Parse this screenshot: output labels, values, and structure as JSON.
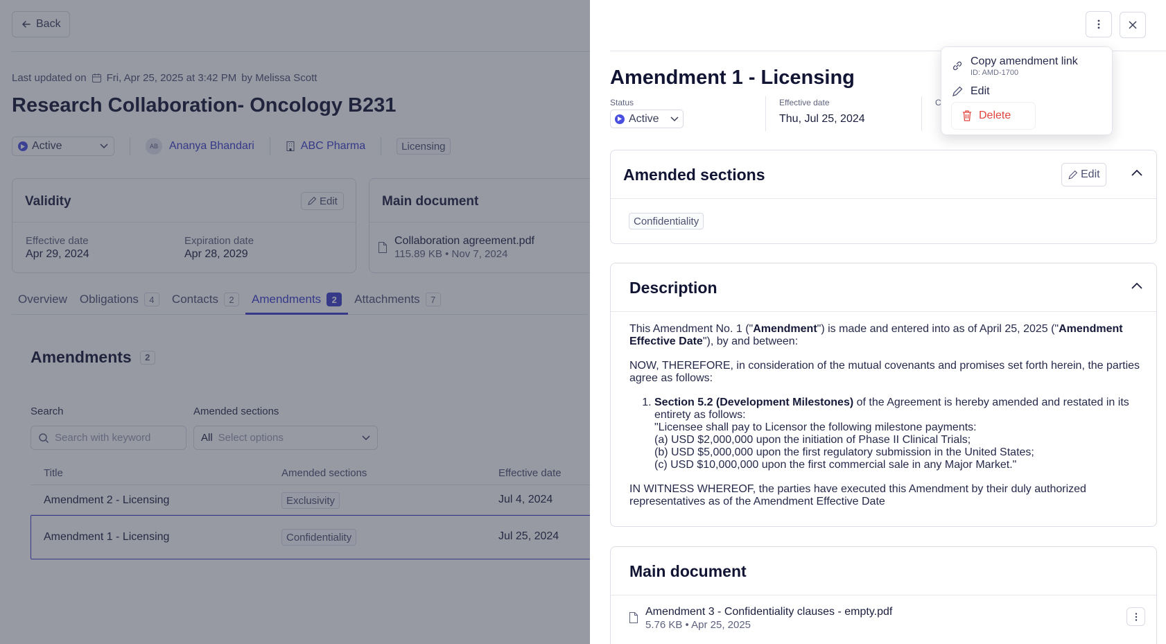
{
  "header": {
    "back_label": "Back",
    "last_updated_prefix": "Last updated on",
    "last_updated_date": "Fri, Apr 25, 2025 at 3:42 PM",
    "last_updated_by": "by Melissa Scott",
    "title": "Research Collaboration- Oncology B231",
    "status": "Active",
    "owner_initials": "AB",
    "owner_name": "Ananya Bhandari",
    "company": "ABC Pharma",
    "category": "Licensing"
  },
  "validity": {
    "title": "Validity",
    "edit_label": "Edit",
    "effective_label": "Effective date",
    "effective_value": "Apr 29, 2024",
    "expiration_label": "Expiration date",
    "expiration_value": "Apr 28, 2029"
  },
  "main_document_card": {
    "title": "Main document",
    "file_name": "Collaboration agreement.pdf",
    "file_meta": "115.89 KB • Nov 7, 2024"
  },
  "tabs": [
    {
      "label": "Overview",
      "count": ""
    },
    {
      "label": "Obligations",
      "count": "4"
    },
    {
      "label": "Contacts",
      "count": "2"
    },
    {
      "label": "Amendments",
      "count": "2"
    },
    {
      "label": "Attachments",
      "count": "7"
    }
  ],
  "amendments": {
    "title": "Amendments",
    "count": "2",
    "search_label": "Search",
    "search_placeholder": "Search with keyword",
    "sections_label": "Amended sections",
    "sections_all": "All",
    "sections_placeholder": "Select options",
    "columns": [
      "Title",
      "Amended sections",
      "Effective date"
    ],
    "rows": [
      {
        "title": "Amendment 2 - Licensing",
        "section": "Exclusivity",
        "date": "Jul 4, 2024"
      },
      {
        "title": "Amendment 1 - Licensing",
        "section": "Confidentiality",
        "date": "Jul 25, 2024"
      }
    ]
  },
  "panel": {
    "title": "Amendment 1 - Licensing",
    "status_label": "Status",
    "status_value": "Active",
    "effective_label": "Effective date",
    "effective_value": "Thu, Jul 25, 2024",
    "third_label_fragment": "C",
    "amended_sections": {
      "title": "Amended sections",
      "edit_label": "Edit",
      "tag": "Confidentiality"
    },
    "description": {
      "title": "Description",
      "p1_a": "This Amendment No. 1 (\"",
      "p1_b": "Amendment",
      "p1_c": "\") is made and entered into as of April 25, 2025 (\"",
      "p1_d": "Amendment Effective Date",
      "p1_e": "\"), by and between:",
      "p2": "NOW, THEREFORE, in consideration of the mutual covenants and promises set forth herein, the parties agree as follows:",
      "li_bold": "Section 5.2 (Development Milestones)",
      "li_rest": " of the Agreement is hereby amended and restated in its entirety as follows:",
      "li_line1": "\"Licensee shall pay to Licensor the following milestone payments:",
      "li_line2": "(a) USD $2,000,000 upon the initiation of Phase II Clinical Trials;",
      "li_line3": "(b) USD $5,000,000 upon the first regulatory submission in the United States;",
      "li_line4": "(c) USD $10,000,000 upon the first commercial sale in any Major Market.\"",
      "p3": "IN WITNESS WHEREOF, the parties have executed this Amendment by their duly authorized representatives as of the Amendment Effective Date"
    },
    "main_document": {
      "title": "Main document",
      "file_name": "Amendment 3 - Confidentiality clauses - empty.pdf",
      "file_meta": "5.76 KB • Apr 25, 2025"
    }
  },
  "menu": {
    "copy_label": "Copy amendment link",
    "copy_id": "ID: AMD-1700",
    "edit_label": "Edit",
    "delete_label": "Delete"
  },
  "colors": {
    "accent": "#3a3fc9",
    "danger": "#e0443e",
    "overlay": "#303448"
  }
}
